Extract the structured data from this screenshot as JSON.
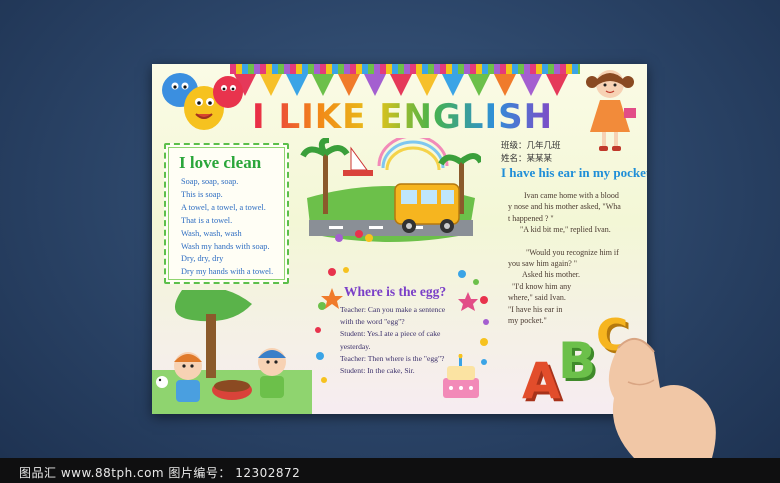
{
  "poster": {
    "title": "I LIKE ENGLISH",
    "class_label": "班级：几年几班",
    "name_label": "姓名：某某某",
    "love_clean": {
      "title": "I love clean",
      "lines": [
        "Soap, soap, soap.",
        "This is soap.",
        "A towel, a towel, a towel.",
        "That is a towel.",
        "Wash, wash, wash",
        "Wash my hands with soap.",
        "Dry, dry, dry",
        "Dry my hands with a towel."
      ]
    },
    "ear_story": {
      "title": "I have his ear in my pocket",
      "lines": [
        "Ivan came home with a blood",
        "y nose and his mother asked, \"Wha",
        "t happened ? \"",
        "\"A kid bit me,\" replied Ivan.",
        "",
        "\"Would you recognize him if",
        "you saw him again? \"",
        "Asked his mother.",
        "\"I'd know him any",
        "where,\" said Ivan.",
        "\"I have his ear in",
        "my pocket.\""
      ]
    },
    "egg_story": {
      "title": "Where is the egg?",
      "lines": [
        "Teacher: Can you make a sentence",
        "with the word \"egg\"?",
        "Student: Yes.I ate a piece of cake",
        "yesterday.",
        "Teacher: Then where is the \"egg\"?",
        "Student: In the cake, Sir."
      ]
    },
    "decor_letters": [
      "A",
      "B",
      "C"
    ]
  },
  "footer": {
    "text": "图品汇  www.88tph.com  图片编号： 12302872"
  },
  "colors": {
    "background": "#2a4366",
    "title_gradient_start": "#e8274a",
    "title_gradient_end": "#8d3fc4",
    "clean_title": "#2aa63a",
    "ear_title": "#1f8ed8",
    "egg_title": "#7a3fc8"
  }
}
